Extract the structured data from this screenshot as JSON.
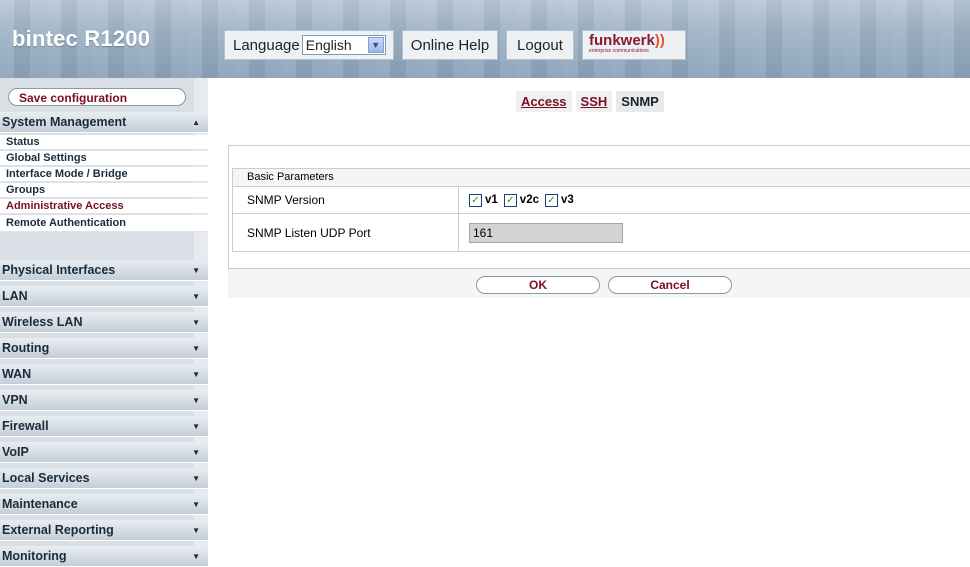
{
  "header": {
    "app_title": "bintec R1200",
    "language_label": "Language",
    "language_value": "English",
    "online_help": "Online Help",
    "logout": "Logout",
    "brand_name": "funkwerk",
    "brand_tagline": "enterprise communications"
  },
  "sidebar": {
    "save_configuration": "Save configuration",
    "system_management": "System Management",
    "system_items": [
      "Status",
      "Global Settings",
      "Interface Mode / Bridge",
      "Groups",
      "Administrative Access",
      "Remote Authentication"
    ],
    "sections": [
      "Physical Interfaces",
      "LAN",
      "Wireless LAN",
      "Routing",
      "WAN",
      "VPN",
      "Firewall",
      "VoIP",
      "Local Services",
      "Maintenance",
      "External Reporting",
      "Monitoring"
    ]
  },
  "tabs": {
    "access": "Access",
    "ssh": "SSH",
    "snmp": "SNMP",
    "active": "SNMP"
  },
  "form": {
    "section_title": "Basic Parameters",
    "snmp_version_label": "SNMP Version",
    "versions": [
      {
        "label": "v1",
        "checked": true
      },
      {
        "label": "v2c",
        "checked": true
      },
      {
        "label": "v3",
        "checked": true
      }
    ],
    "port_label": "SNMP Listen UDP Port",
    "port_value": "161",
    "ok": "OK",
    "cancel": "Cancel"
  },
  "colors": {
    "accent": "#7a0f22",
    "sidebar_bg": "#d9dfe5",
    "header_bg": "#9fb3c6"
  }
}
